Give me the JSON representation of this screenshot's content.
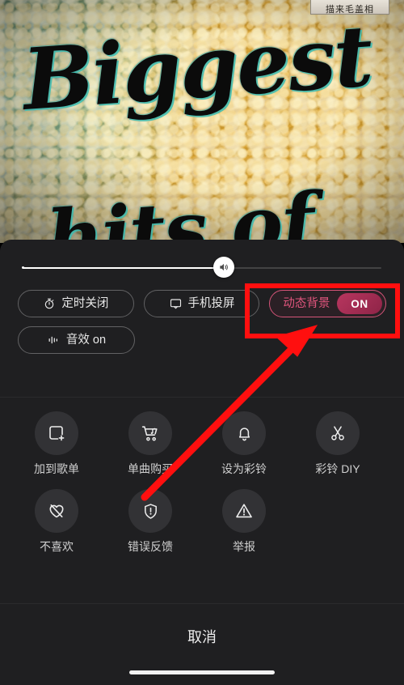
{
  "artwork": {
    "line1": "Biggest",
    "line2": "hits of",
    "tag_text": "描来毛盖相"
  },
  "player_sheet": {
    "volume": {
      "name": "volume-slider",
      "value_percent": 56,
      "thumb_icon": "speaker-volume-icon"
    },
    "pills": [
      {
        "label": "定时关闭",
        "icon": "stopwatch-icon",
        "state": ""
      },
      {
        "label": "手机投屏",
        "icon": "cast-screen-icon",
        "state": ""
      },
      {
        "label": "动态背景",
        "icon": "",
        "state": "ON",
        "highlighted": true
      },
      {
        "label": "音效 on",
        "icon": "equalizer-icon",
        "state": ""
      }
    ],
    "actions_row1": [
      {
        "label": "加到歌单",
        "icon": "add-to-playlist-icon"
      },
      {
        "label": "单曲购买",
        "icon": "cart-music-icon"
      },
      {
        "label": "设为彩铃",
        "icon": "bell-icon"
      },
      {
        "label": "彩铃 DIY",
        "icon": "scissors-icon"
      }
    ],
    "actions_row2": [
      {
        "label": "不喜欢",
        "icon": "heart-broken-icon"
      },
      {
        "label": "错误反馈",
        "icon": "shield-exclamation-icon"
      },
      {
        "label": "举报",
        "icon": "warning-triangle-icon"
      }
    ],
    "cancel_label": "取消"
  },
  "annotation": {
    "highlight_color": "#ff0f0f",
    "target": "动态背景 ON",
    "shapes": [
      "rectangle",
      "arrow"
    ]
  },
  "colors": {
    "sheet_background": "#1f1f21",
    "icon_circle": "#323235",
    "accent_pink": "#e0557d",
    "toggle_on": "#b8365f",
    "annotation_red": "#ff0f0f"
  }
}
